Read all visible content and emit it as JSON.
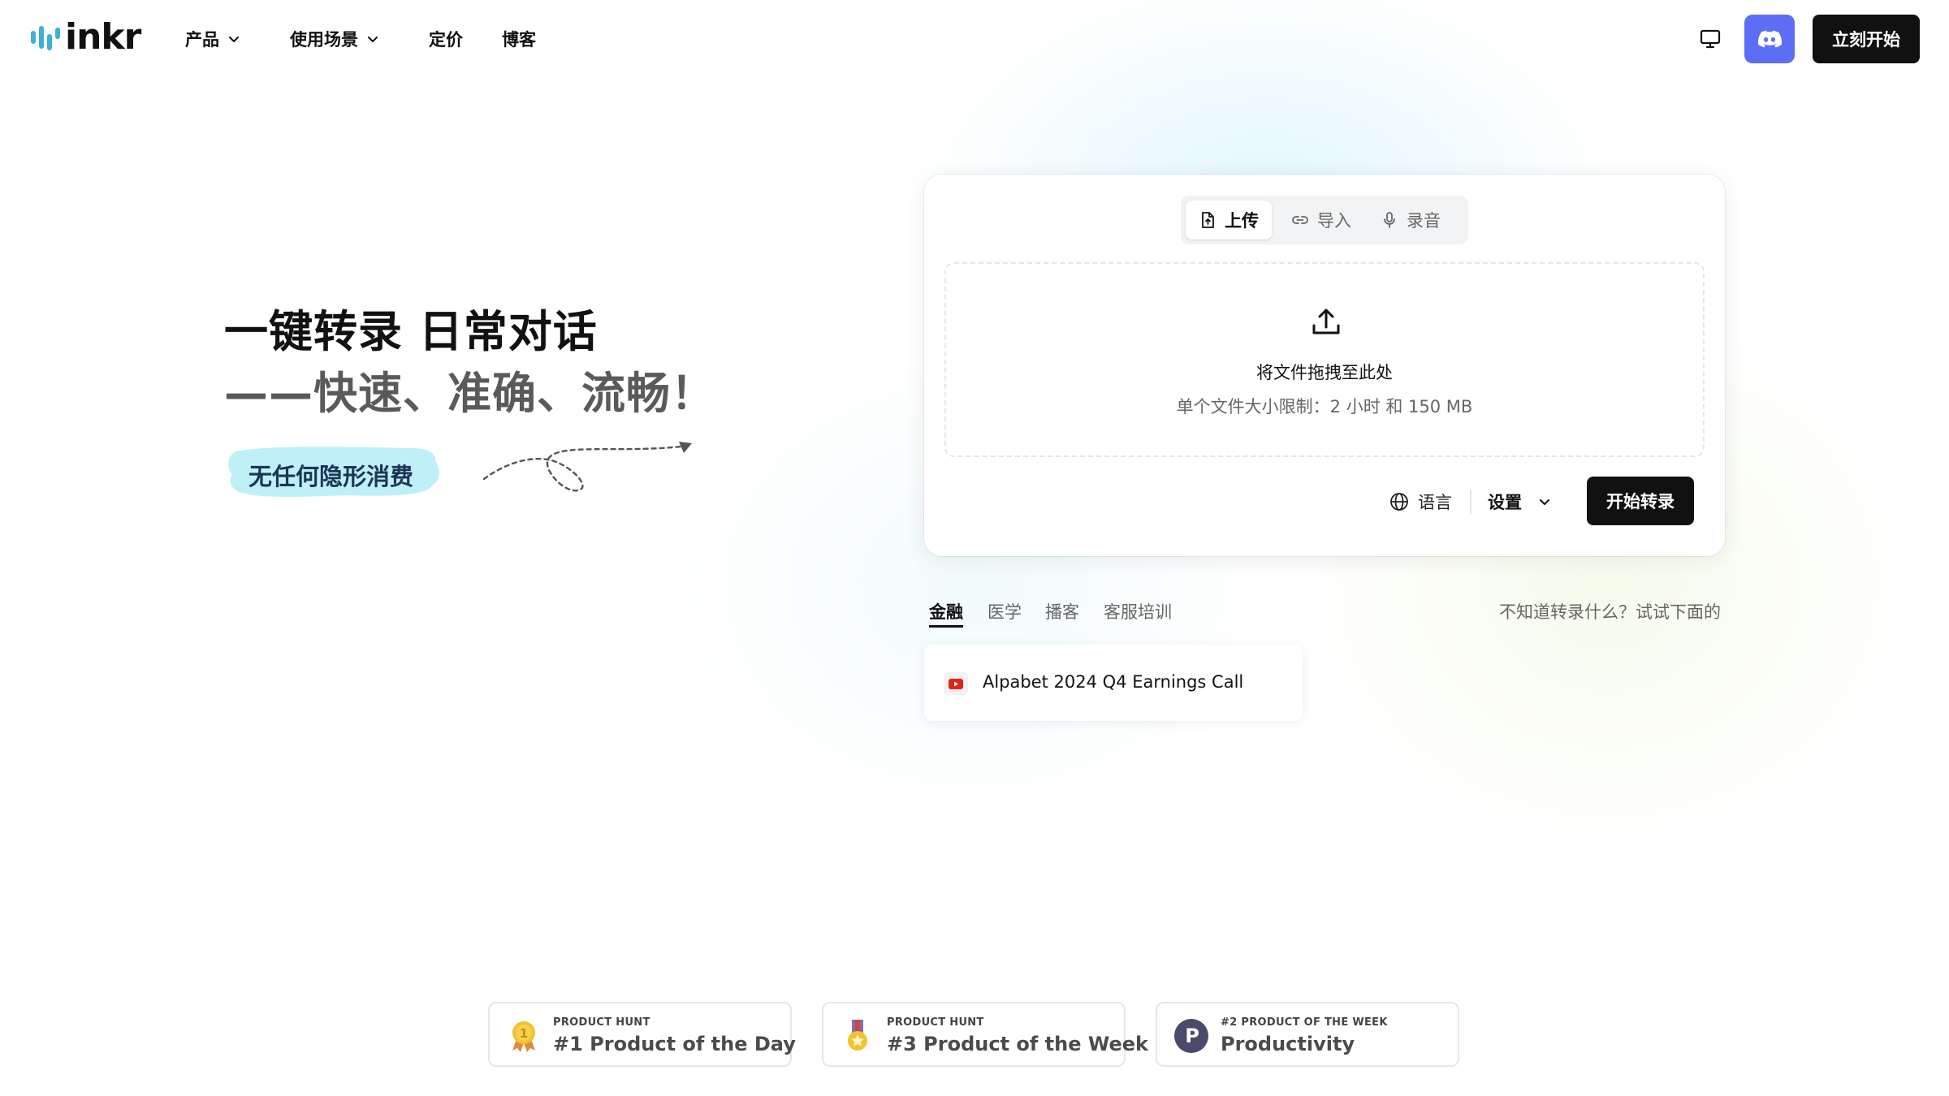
{
  "nav": {
    "logo_text": "inkr",
    "items": [
      {
        "label": "产品",
        "has_dropdown": true
      },
      {
        "label": "使用场景",
        "has_dropdown": true
      },
      {
        "label": "定价",
        "has_dropdown": false
      },
      {
        "label": "博客",
        "has_dropdown": false
      }
    ],
    "start_label": "立刻开始",
    "icons": {
      "monitor": "monitor-icon",
      "discord": "discord-icon"
    },
    "discord_color": "#5b6ef5"
  },
  "hero": {
    "title": "一键转录 日常对话",
    "subtitle": "——快速、准确、流畅！",
    "badge": "无任何隐形消费",
    "badge_color": "#bff0f7"
  },
  "upload": {
    "tabs": [
      {
        "label": "上传",
        "icon": "file-upload-icon",
        "active": true
      },
      {
        "label": "导入",
        "icon": "link-icon",
        "active": false
      },
      {
        "label": "录音",
        "icon": "microphone-icon",
        "active": false
      }
    ],
    "drop_title": "将文件拖拽至此处",
    "drop_subtitle": "单个文件大小限制：2 小时 和 150 MB",
    "language_label": "语言",
    "settings_label": "设置",
    "transcribe_label": "开始转录"
  },
  "examples": {
    "categories": [
      {
        "label": "金融",
        "active": true
      },
      {
        "label": "医学",
        "active": false
      },
      {
        "label": "播客",
        "active": false
      },
      {
        "label": "客服培训",
        "active": false
      }
    ],
    "hint": "不知道转录什么？试试下面的",
    "items": [
      {
        "title": "Alpabet 2024 Q4 Earnings Call",
        "icon": "youtube-icon"
      }
    ]
  },
  "awards": [
    {
      "small": "PRODUCT HUNT",
      "big": "#1 Product of the Day",
      "icon": "gold-medal-icon"
    },
    {
      "small": "PRODUCT HUNT",
      "big": "#3 Product of the Week",
      "icon": "bronze-medal-icon"
    },
    {
      "small": "#2 PRODUCT OF THE WEEK",
      "big": "Productivity",
      "icon": "product-hunt-logo-icon"
    }
  ]
}
